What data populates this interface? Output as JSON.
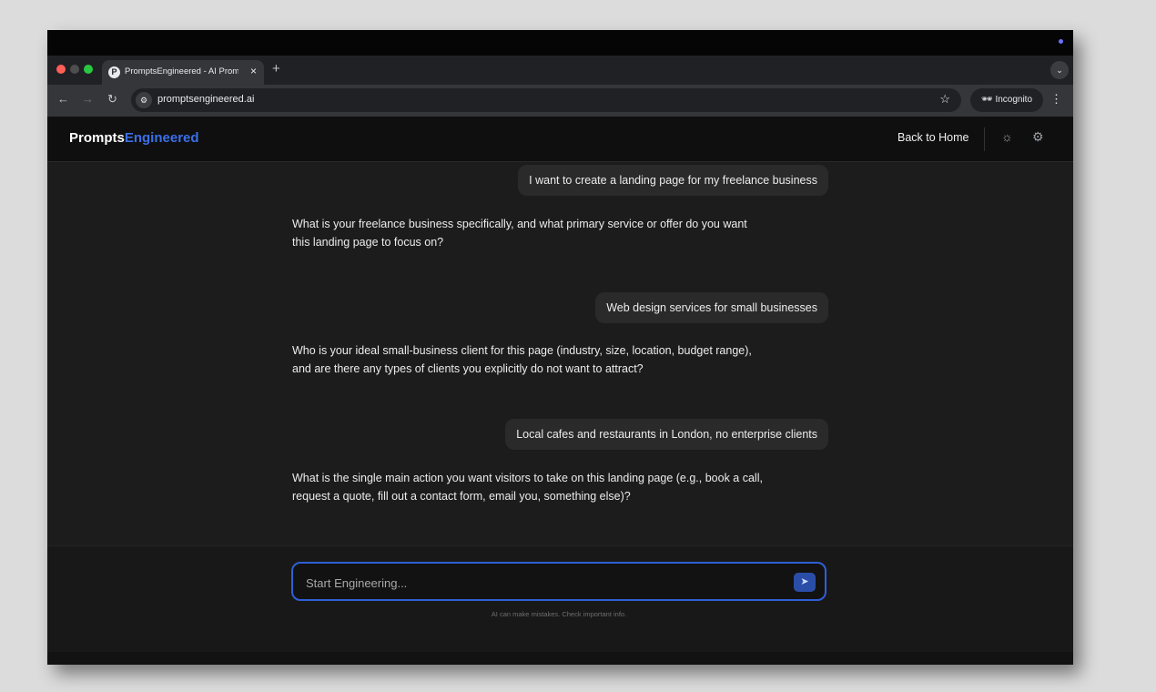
{
  "browser": {
    "tab_title": "PromptsEngineered - AI Prom",
    "tab_favicon": "P",
    "tab_close": "×",
    "new_tab": "+",
    "url": "promptsengineered.ai",
    "incognito_label": "Incognito",
    "window_colors": {
      "close": "#ff5f57",
      "minimize": "#4e4e4e",
      "maximize": "#28c840"
    },
    "indicator_color": "#6b73ff"
  },
  "app": {
    "logo_part1": "Prompts",
    "logo_part2": "Engineered",
    "colors": {
      "logo_primary": "#ffffff",
      "logo_accent": "#3b6fe8"
    },
    "back_to_home": "Back to Home"
  },
  "chat": {
    "messages": [
      {
        "role": "user",
        "text": "I want to create a landing page for my freelance business"
      },
      {
        "role": "assistant",
        "text": "What is your freelance business specifically, and what primary service or offer do you want this landing page to focus on?"
      },
      {
        "role": "user",
        "text": "Web design services for small businesses"
      },
      {
        "role": "assistant",
        "text": "Who is your ideal small-business client for this page (industry, size, location, budget range), and are there any types of clients you explicitly do not want to attract?"
      },
      {
        "role": "user",
        "text": "Local cafes and restaurants in London, no enterprise clients"
      },
      {
        "role": "assistant",
        "text": "What is the single main action you want visitors to take on this landing page (e.g., book a call, request a quote, fill out a contact form, email you, something else)?"
      }
    ]
  },
  "composer": {
    "placeholder": "Start Engineering...",
    "disclaimer": "AI can make mistakes. Check important info.",
    "accent_color": "#2f5fd6"
  },
  "icons": {
    "back": "arrow-left-icon",
    "forward": "arrow-right-icon",
    "reload": "reload-icon",
    "site_info": "site-info-icon",
    "bookmark": "star-icon",
    "incognito": "incognito-icon",
    "menu": "kebab-menu-icon",
    "theme": "sun-icon",
    "settings": "gear-icon",
    "send": "send-icon"
  }
}
